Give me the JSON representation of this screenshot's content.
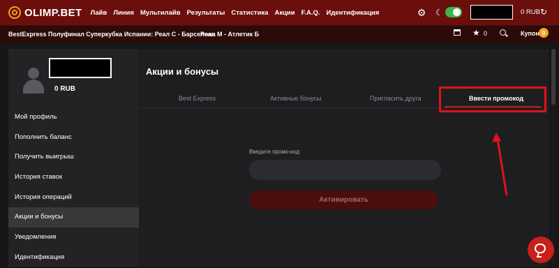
{
  "header": {
    "logo_text": "OLIMP.BET",
    "nav": [
      "Лайв",
      "Линия",
      "Мультилайв",
      "Результаты",
      "Статистика",
      "Акции",
      "F.A.Q.",
      "Идентификация"
    ],
    "balance": "0 RUB"
  },
  "subbar": {
    "items": [
      "BestExpress",
      "Полуфинал Суперкубка Испании: Реал С - Барселона",
      "Реал М - Атлетик Б"
    ],
    "favorites_count": "0",
    "coupon_label": "Купон",
    "coupon_count": "0"
  },
  "sidebar": {
    "balance": "0 RUB",
    "menu": [
      "Мой профиль",
      "Пополнить баланс",
      "Получить выигрыш",
      "История ставок",
      "История операций",
      "Акции и бонусы",
      "Уведомления",
      "Идентификация"
    ],
    "active_index": 5
  },
  "main": {
    "title": "Акции и бонусы",
    "tabs": [
      "Best Express",
      "Активные бонусы",
      "Пригласить друга",
      "Ввести промокод"
    ],
    "active_tab": 3,
    "promo_label": "Введите промо-код:",
    "promo_value": "",
    "activate_label": "Активировать"
  },
  "colors": {
    "topbar": "#6b0f0c",
    "accent": "#c41d16",
    "toggle_on": "#3ab54a",
    "coupon_badge": "#f2a71b",
    "annotation": "#e0121a"
  }
}
